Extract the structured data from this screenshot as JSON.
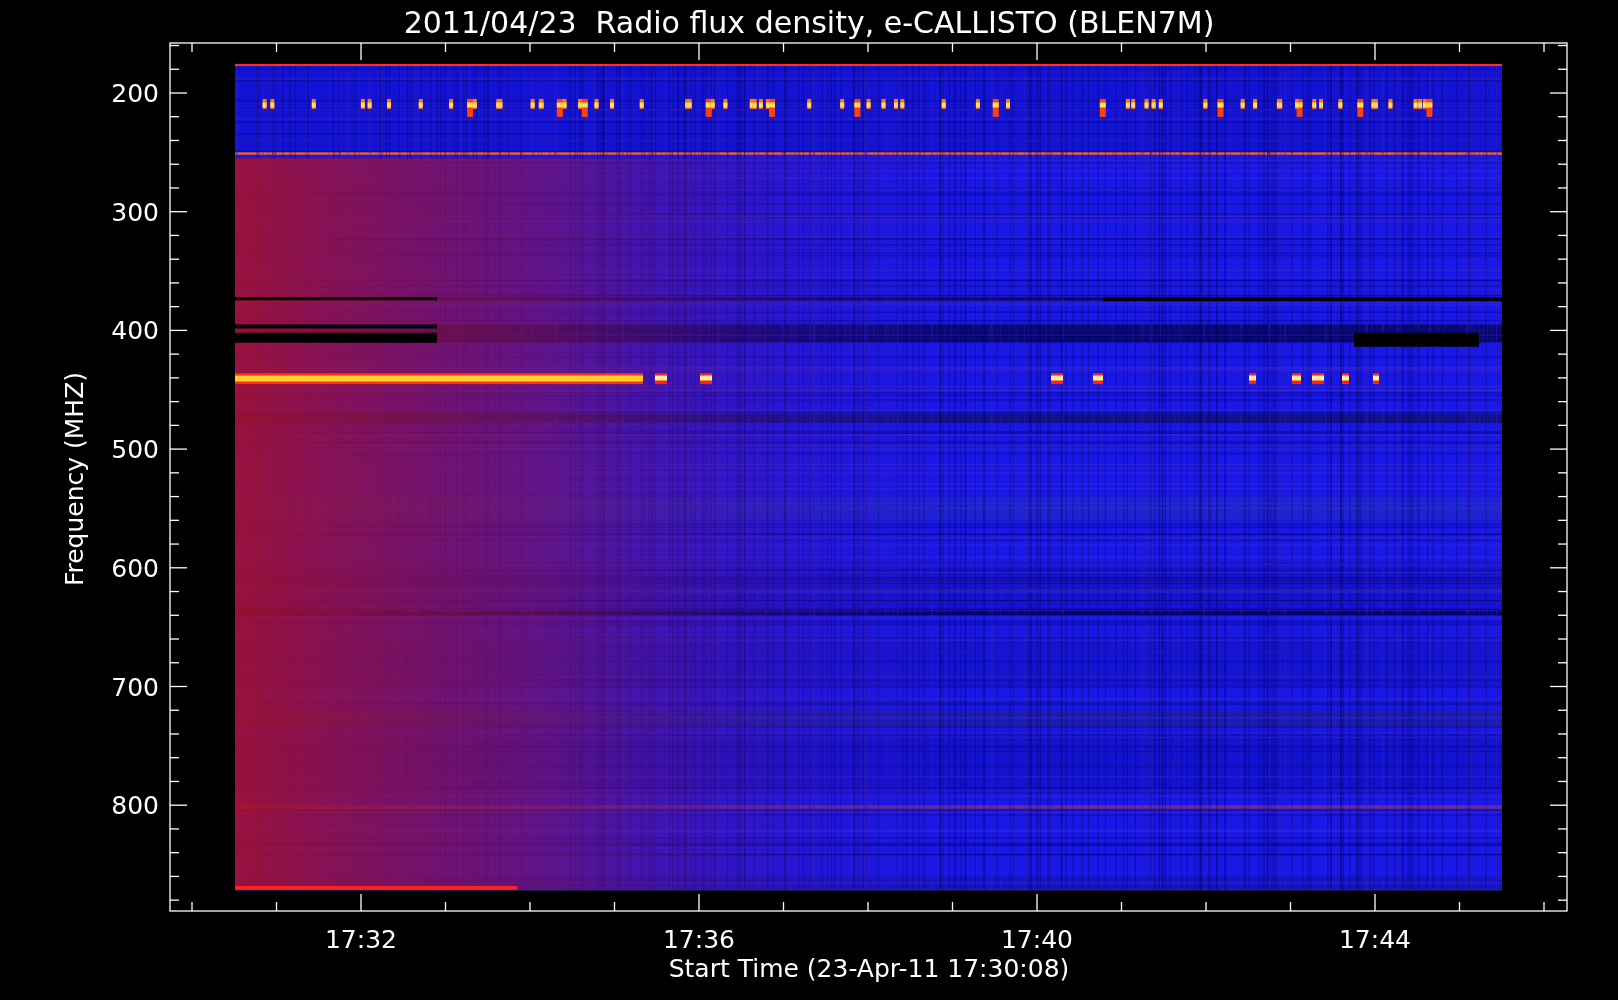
{
  "title": "2011/04/23  Radio flux density, e-CALLISTO (BLEN7M)",
  "y_axis": {
    "label": "Frequency (MHZ)",
    "ticks": [
      "200",
      "300",
      "400",
      "500",
      "600",
      "700",
      "800"
    ]
  },
  "x_axis": {
    "label": "Start Time (23-Apr-11 17:30:08)",
    "ticks": [
      "17:32",
      "17:36",
      "17:40",
      "17:44"
    ]
  }
}
